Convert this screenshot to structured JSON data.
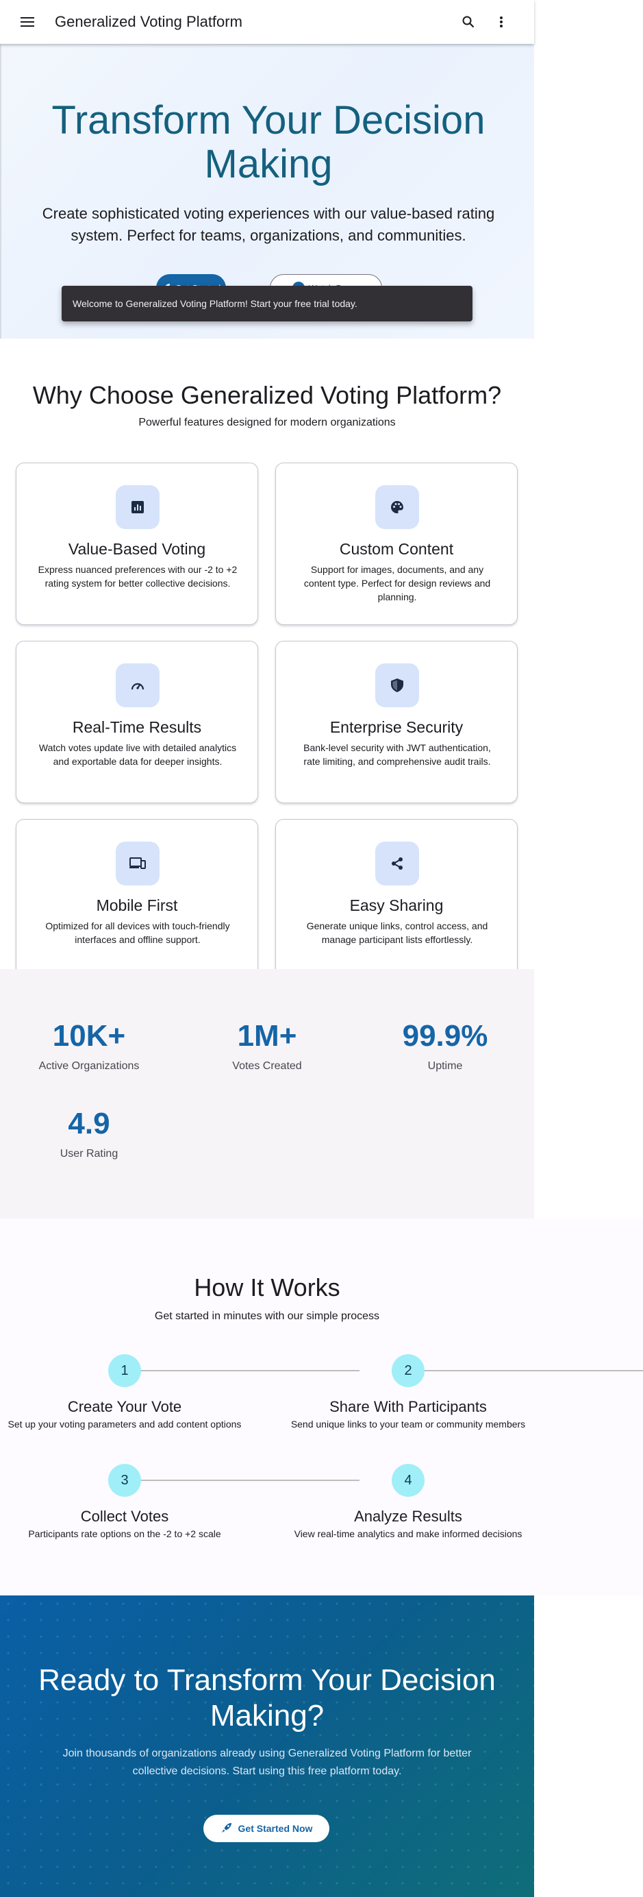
{
  "app_bar": {
    "title": "Generalized Voting Platform",
    "menu_icon": "menu-icon",
    "search_icon": "search-icon",
    "more_icon": "more-vert-icon"
  },
  "hero": {
    "title": "Transform Your Decision Making",
    "subtitle": "Create sophisticated voting experiences with our value-based rating system. Perfect for teams, organizations, and communities.",
    "primary_button": "Get Started",
    "secondary_button": "Watch Demo"
  },
  "snackbar": {
    "message": "Welcome to Generalized Voting Platform! Start your free trial today."
  },
  "features": {
    "title": "Why Choose Generalized Voting Platform?",
    "subtitle": "Powerful features designed for modern organizations",
    "cards": [
      {
        "icon": "analytics-icon",
        "title": "Value-Based Voting",
        "description": "Express nuanced preferences with our -2 to +2 rating system for better collective decisions."
      },
      {
        "icon": "palette-icon",
        "title": "Custom Content",
        "description": "Support for images, documents, and any content type. Perfect for design reviews and planning."
      },
      {
        "icon": "speed-icon",
        "title": "Real-Time Results",
        "description": "Watch votes update live with detailed analytics and exportable data for deeper insights."
      },
      {
        "icon": "shield-icon",
        "title": "Enterprise Security",
        "description": "Bank-level security with JWT authentication, rate limiting, and comprehensive audit trails."
      },
      {
        "icon": "devices-icon",
        "title": "Mobile First",
        "description": "Optimized for all devices with touch-friendly interfaces and offline support."
      },
      {
        "icon": "share-icon",
        "title": "Easy Sharing",
        "description": "Generate unique links, control access, and manage participant lists effortlessly."
      }
    ]
  },
  "stats": [
    {
      "value": "10K+",
      "label": "Active Organizations"
    },
    {
      "value": "1M+",
      "label": "Votes Created"
    },
    {
      "value": "99.9%",
      "label": "Uptime"
    },
    {
      "value": "4.9",
      "label": "User Rating"
    }
  ],
  "how_it_works": {
    "title": "How It Works",
    "subtitle": "Get started in minutes with our simple process",
    "steps": [
      {
        "number": "1",
        "title": "Create Your Vote",
        "description": "Set up your voting parameters and add content options"
      },
      {
        "number": "2",
        "title": "Share With Participants",
        "description": "Send unique links to your team or community members"
      },
      {
        "number": "3",
        "title": "Collect Votes",
        "description": "Participants rate options on the -2 to +2 scale"
      },
      {
        "number": "4",
        "title": "Analyze Results",
        "description": "View real-time analytics and make informed decisions"
      }
    ]
  },
  "cta": {
    "title": "Ready to Transform Your Decision Making?",
    "text": "Join thousands of organizations already using Generalized Voting Platform for better collective decisions. Start using this free platform today.",
    "button": "Get Started Now"
  },
  "colors": {
    "primary": "#1565a7",
    "hero_title": "#14607e",
    "step_circle": "#a0eef8",
    "feature_icon_bg": "#d6e3fb"
  }
}
